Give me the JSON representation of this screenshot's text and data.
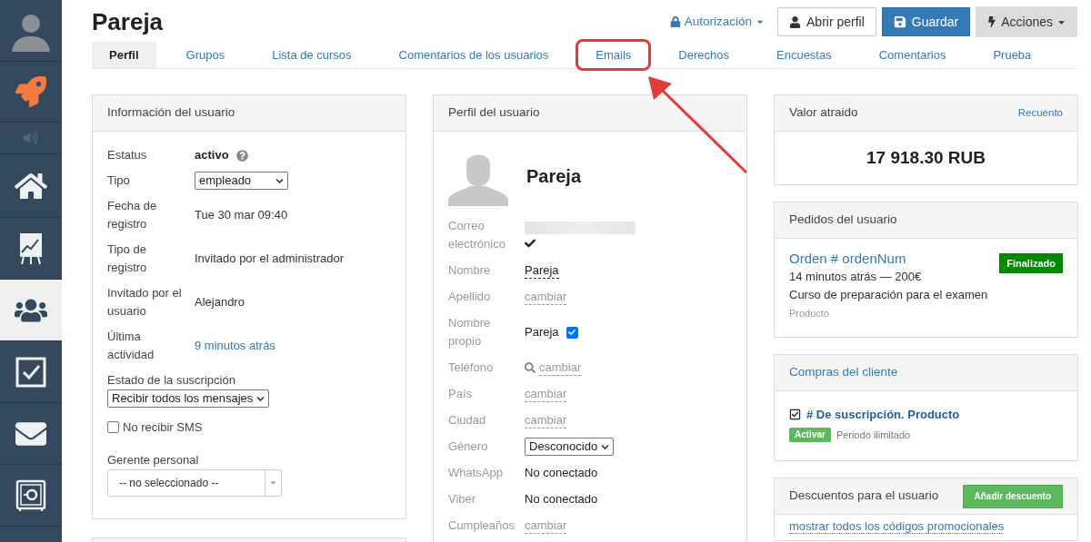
{
  "sidebar": {
    "items": [
      {
        "kind": "avatar",
        "selected": false
      },
      {
        "kind": "rocket",
        "selected": false
      },
      {
        "kind": "speaker",
        "selected": false
      },
      {
        "kind": "home",
        "selected": false
      },
      {
        "kind": "chart",
        "selected": false
      },
      {
        "kind": "users",
        "selected": true
      },
      {
        "kind": "tasks",
        "selected": false
      },
      {
        "kind": "mail",
        "selected": false
      },
      {
        "kind": "safe",
        "selected": false
      }
    ]
  },
  "header": {
    "title": "Pareja",
    "authorization": "Autorización",
    "buttons": [
      {
        "kind": "default",
        "label": "Abrir perfil"
      },
      {
        "kind": "primary",
        "label": "Guardar"
      },
      {
        "kind": "dropdown",
        "label": "Acciones"
      }
    ]
  },
  "tabs": [
    {
      "label": "Perfil",
      "selected": true,
      "annotated": false
    },
    {
      "label": "Grupos",
      "selected": false,
      "annotated": false
    },
    {
      "label": "Lista de cursos",
      "selected": false,
      "annotated": false
    },
    {
      "label": "Comentarios de los usuarios",
      "selected": false,
      "annotated": false
    },
    {
      "label": "Emails",
      "selected": false,
      "annotated": true
    },
    {
      "label": "Derechos",
      "selected": false,
      "annotated": false
    },
    {
      "label": "Encuestas",
      "selected": false,
      "annotated": false
    },
    {
      "label": "Comentarios",
      "selected": false,
      "annotated": false
    },
    {
      "label": "Prueba",
      "selected": false,
      "annotated": false
    }
  ],
  "user_info": {
    "title": "Información del usuario",
    "rows": [
      {
        "kind": "status",
        "label": "Estatus",
        "value": "activo"
      },
      {
        "kind": "select",
        "label": "Tipo",
        "value": "empleado"
      },
      {
        "kind": "text",
        "label": "Fecha de registro",
        "value": "Tue 30 mar 09:40"
      },
      {
        "kind": "text",
        "label": "Tipo de registro",
        "value": "Invitado por el administrador"
      },
      {
        "kind": "text",
        "label": "Invitado por el usuario",
        "value": "Alejandro"
      },
      {
        "kind": "link",
        "label": "Última actividad",
        "value": "9 minutos atrás"
      }
    ],
    "subscription": {
      "label": "Estado de la suscripción",
      "value": "Recibir todos los mensajes"
    },
    "no_sms": {
      "label": "No recibir SMS",
      "checked": false
    },
    "manager": {
      "label": "Gerente personal",
      "value": "-- no seleccionado --"
    }
  },
  "user_profile": {
    "title": "Perfil del usuario",
    "name": "Pareja",
    "rows": [
      {
        "kind": "email",
        "label": "Correo electrónico",
        "verified": true
      },
      {
        "kind": "editable",
        "label": "Nombre",
        "value": "Pareja"
      },
      {
        "kind": "change",
        "label": "Apellido",
        "value": "cambiar"
      },
      {
        "kind": "check",
        "label": "Nombre propio",
        "value": "Pareja",
        "checked": true
      },
      {
        "kind": "phone",
        "label": "Teléfono",
        "value": "cambiar"
      },
      {
        "kind": "change",
        "label": "País",
        "value": "cambiar"
      },
      {
        "kind": "change",
        "label": "Ciudad",
        "value": "cambiar"
      },
      {
        "kind": "select",
        "label": "Género",
        "value": "Desconocido"
      },
      {
        "kind": "text",
        "label": "WhatsApp",
        "value": "No conectado"
      },
      {
        "kind": "text",
        "label": "Viber",
        "value": "No conectado"
      },
      {
        "kind": "change",
        "label": "Cumpleaños",
        "value": "cambiar"
      }
    ]
  },
  "attracted_value": {
    "title": "Valor atraido",
    "link": "Recuento",
    "value": "17 918.30 RUB"
  },
  "orders": {
    "title": "Pedidos del usuario",
    "items": [
      {
        "title": "Orden # ordenNum",
        "status": "Finalizado",
        "meta": "14 minutos atrás — 200€",
        "product": "Curso de preparación para el examen",
        "type": "Producto"
      }
    ]
  },
  "purchases": {
    "title": "Compras del cliente",
    "items": [
      {
        "title": "# De suscripción. Producto",
        "badge": "Activar",
        "period": "Periodo ilimitado"
      }
    ]
  },
  "discounts": {
    "title": "Descuentos para el usuario",
    "button": "Añadir descuento",
    "link": "mostrar todos los códigos promocionales"
  }
}
